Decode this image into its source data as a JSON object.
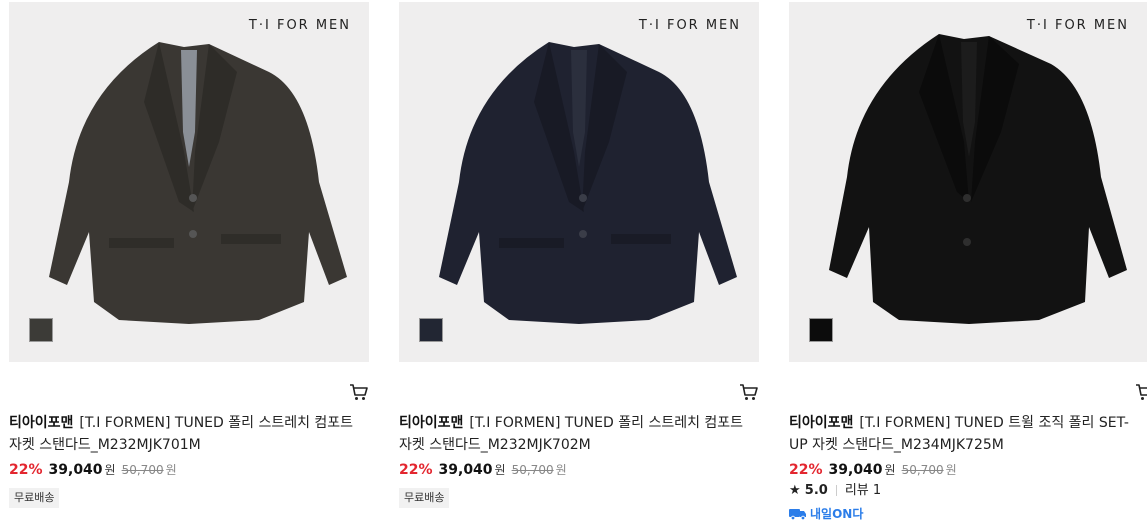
{
  "products": [
    {
      "logo_text": "T·I FOR MEN",
      "jacket_color": "#3a3733",
      "swatch_color": "#3c3b37",
      "brand": "티아이포맨",
      "name": "[T.I FORMEN] TUNED 폴리 스트레치 컴포트 자켓 스탠다드_M232MJK701M",
      "discount": "22%",
      "price": "39,040",
      "price_unit": "원",
      "original_price": "50,700",
      "original_unit": "원",
      "badge": "무료배송"
    },
    {
      "logo_text": "T·I FOR MEN",
      "jacket_color": "#1f2230",
      "swatch_color": "#222633",
      "brand": "티아이포맨",
      "name": "[T.I FORMEN] TUNED 폴리 스트레치 컴포트 자켓 스탠다드_M232MJK702M",
      "discount": "22%",
      "price": "39,040",
      "price_unit": "원",
      "original_price": "50,700",
      "original_unit": "원",
      "badge": "무료배송"
    },
    {
      "logo_text": "T·I FOR MEN",
      "jacket_color": "#121212",
      "swatch_color": "#0c0c0c",
      "brand": "티아이포맨",
      "name": "[T.I FORMEN] TUNED 트윌 조직 폴리 SET-UP 자켓 스탠다드_M234MJK725M",
      "discount": "22%",
      "price": "39,040",
      "price_unit": "원",
      "original_price": "50,700",
      "original_unit": "원",
      "rating": "5.0",
      "review_label": "리뷰 1",
      "delivery_label": "내일ON다"
    }
  ],
  "colors": {
    "discount": "#e3262f",
    "delivery": "#2b7de9"
  }
}
